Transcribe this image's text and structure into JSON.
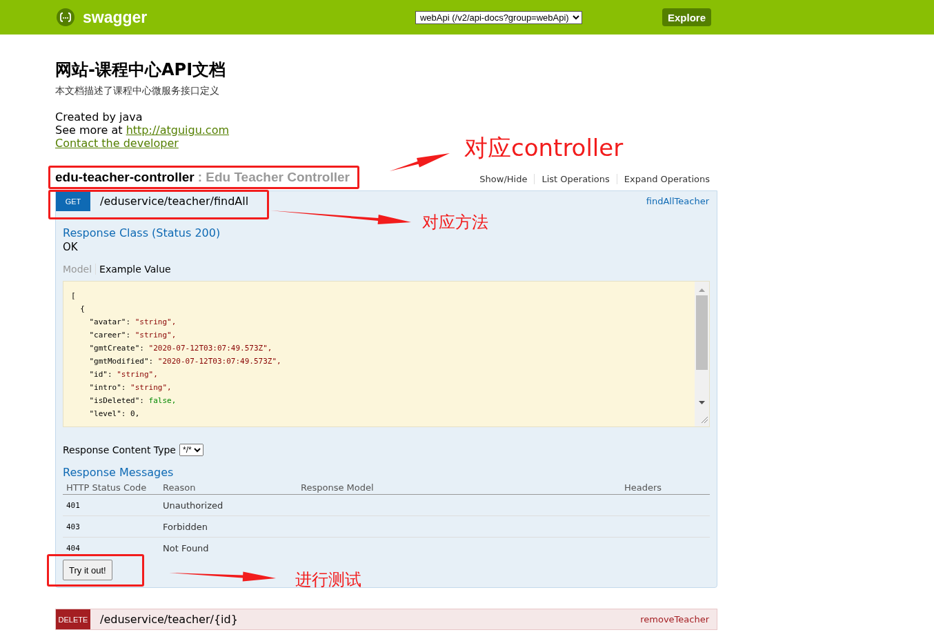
{
  "header": {
    "logo_text": "swagger",
    "api_select": {
      "value": "webApi (/v2/api-docs?group=webApi)"
    },
    "explore_button": "Explore"
  },
  "info": {
    "title": "网站-课程中心API文档",
    "description": "本文档描述了课程中心微服务接口定义",
    "created_by": "Created by java",
    "see_more_label": "See more at",
    "see_more_link": "http://atguigu.com",
    "contact_link": "Contact the developer"
  },
  "resource": {
    "name": "edu-teacher-controller",
    "description": ": Edu Teacher Controller",
    "actions": [
      "Show/Hide",
      "List Operations",
      "Expand Operations"
    ],
    "operations": [
      {
        "method": "GET",
        "path": "/eduservice/teacher/findAll",
        "nickname": "findAllTeacher",
        "expanded": true,
        "response_class": "Response Class (Status 200)",
        "response_class_value": "OK",
        "model_tabs": [
          {
            "label": "Model",
            "selected": false
          },
          {
            "label": "Example Value",
            "selected": true
          }
        ],
        "example": {
          "open": "[",
          "children": [
            {
              "open": "{",
              "children": [
                {
                  "key": "\"avatar\":",
                  "value": "\"string\",",
                  "kind": "string"
                },
                {
                  "key": "\"career\":",
                  "value": "\"string\",",
                  "kind": "string"
                },
                {
                  "key": "\"gmtCreate\":",
                  "value": "\"2020-07-12T03:07:49.573Z\",",
                  "kind": "string"
                },
                {
                  "key": "\"gmtModified\":",
                  "value": "\"2020-07-12T03:07:49.573Z\",",
                  "kind": "string"
                },
                {
                  "key": "\"id\":",
                  "value": "\"string\",",
                  "kind": "string"
                },
                {
                  "key": "\"intro\":",
                  "value": "\"string\",",
                  "kind": "string"
                },
                {
                  "key": "\"isDeleted\":",
                  "value": "false,",
                  "kind": "boolean"
                },
                {
                  "key": "\"level\":",
                  "value": "0,",
                  "kind": "number"
                }
              ]
            }
          ]
        },
        "content_type_label": "Response Content Type",
        "content_type": "*/*",
        "messages_title": "Response Messages",
        "messages_columns": [
          "HTTP Status Code",
          "Reason",
          "Response Model",
          "Headers"
        ],
        "messages": [
          {
            "code": "401",
            "reason": "Unauthorized"
          },
          {
            "code": "403",
            "reason": "Forbidden"
          },
          {
            "code": "404",
            "reason": "Not Found"
          }
        ],
        "try_button": "Try it out!"
      },
      {
        "method": "DELETE",
        "path": "/eduservice/teacher/{id}",
        "nickname": "removeTeacher",
        "expanded": false
      }
    ]
  },
  "annotations": [
    {
      "text": "对应controller"
    },
    {
      "text": "对应方法"
    },
    {
      "text": "进行测试"
    }
  ]
}
